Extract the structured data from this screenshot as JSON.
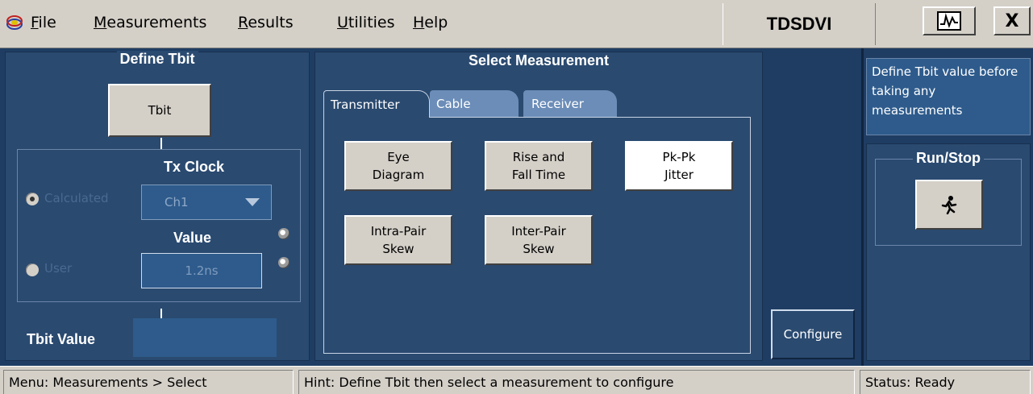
{
  "menubar": {
    "items": [
      {
        "first": "F",
        "rest": "ile"
      },
      {
        "first": "M",
        "rest": "easurements"
      },
      {
        "first": "R",
        "rest": "esults"
      },
      {
        "first": "U",
        "rest": "tilities"
      },
      {
        "first": "H",
        "rest": "elp"
      }
    ],
    "app_title": "TDSDVI",
    "app_icon": "tek-logo-icon",
    "close_label": "X"
  },
  "define_tbit": {
    "title": "Define Tbit",
    "tbit_button": "Tbit",
    "tx_clock_label": "Tx Clock",
    "calculated_label": "Calculated",
    "channel_value": "Ch1",
    "value_label": "Value",
    "user_label": "User",
    "user_value": "1.2ns",
    "tbit_value_label": "Tbit Value",
    "tbit_value": ""
  },
  "select_measurement": {
    "title": "Select Measurement",
    "tabs": [
      "Transmitter",
      "Cable",
      "Receiver"
    ],
    "active_tab": "Transmitter",
    "buttons": [
      {
        "line1": "Eye",
        "line2": "Diagram"
      },
      {
        "line1": "Rise and",
        "line2": "Fall Time"
      },
      {
        "line1": "Pk-Pk",
        "line2": "Jitter"
      },
      {
        "line1": "Intra-Pair",
        "line2": "Skew"
      },
      {
        "line1": "Inter-Pair",
        "line2": "Skew"
      }
    ],
    "selected": "Pk-Pk Jitter",
    "configure_label": "Configure"
  },
  "right_panel": {
    "info_text": "Define Tbit value before taking any measurements",
    "run_stop_title": "Run/Stop",
    "run_icon": "running-man-icon"
  },
  "statusbar": {
    "menu_path": "Menu: Measurements > Select",
    "hint": "Hint: Define Tbit then select a measurement to configure",
    "status": "Status: Ready"
  },
  "colors": {
    "background": "#1f3d63",
    "panel": "#2a4a70",
    "button_face": "#d4d0c8",
    "tab_inactive": "#6b8db8"
  }
}
